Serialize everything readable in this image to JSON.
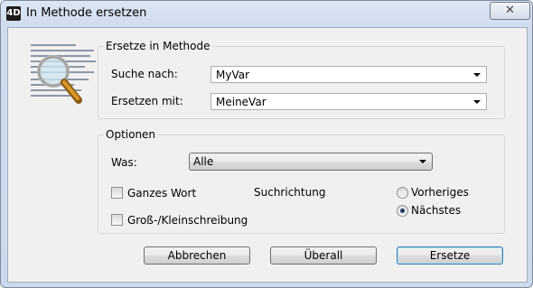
{
  "window": {
    "title": "In Methode ersetzen",
    "app_icon": "4d-logo-icon",
    "close_label": "✕"
  },
  "replace_group": {
    "title": "Ersetze in Methode",
    "search_label": "Suche nach:",
    "search_value": "MyVar",
    "replace_label": "Ersetzen mit:",
    "replace_value": "MeineVar"
  },
  "options_group": {
    "title": "Optionen",
    "what_label": "Was:",
    "what_value": "Alle",
    "whole_word_label": "Ganzes Wort",
    "whole_word_checked": false,
    "case_label": "Groß-/Kleinschreibung",
    "case_checked": false,
    "direction_label": "Suchrichtung",
    "direction_options": [
      "Vorheriges",
      "Nächstes"
    ],
    "direction_selected": "Nächstes"
  },
  "buttons": {
    "cancel": "Abbrechen",
    "all": "Überall",
    "replace": "Ersetze"
  },
  "colors": {
    "title_bar": "#cfdcee",
    "dialog_bg": "#f0f0f0",
    "default_button_border": "#3c7fb1"
  }
}
